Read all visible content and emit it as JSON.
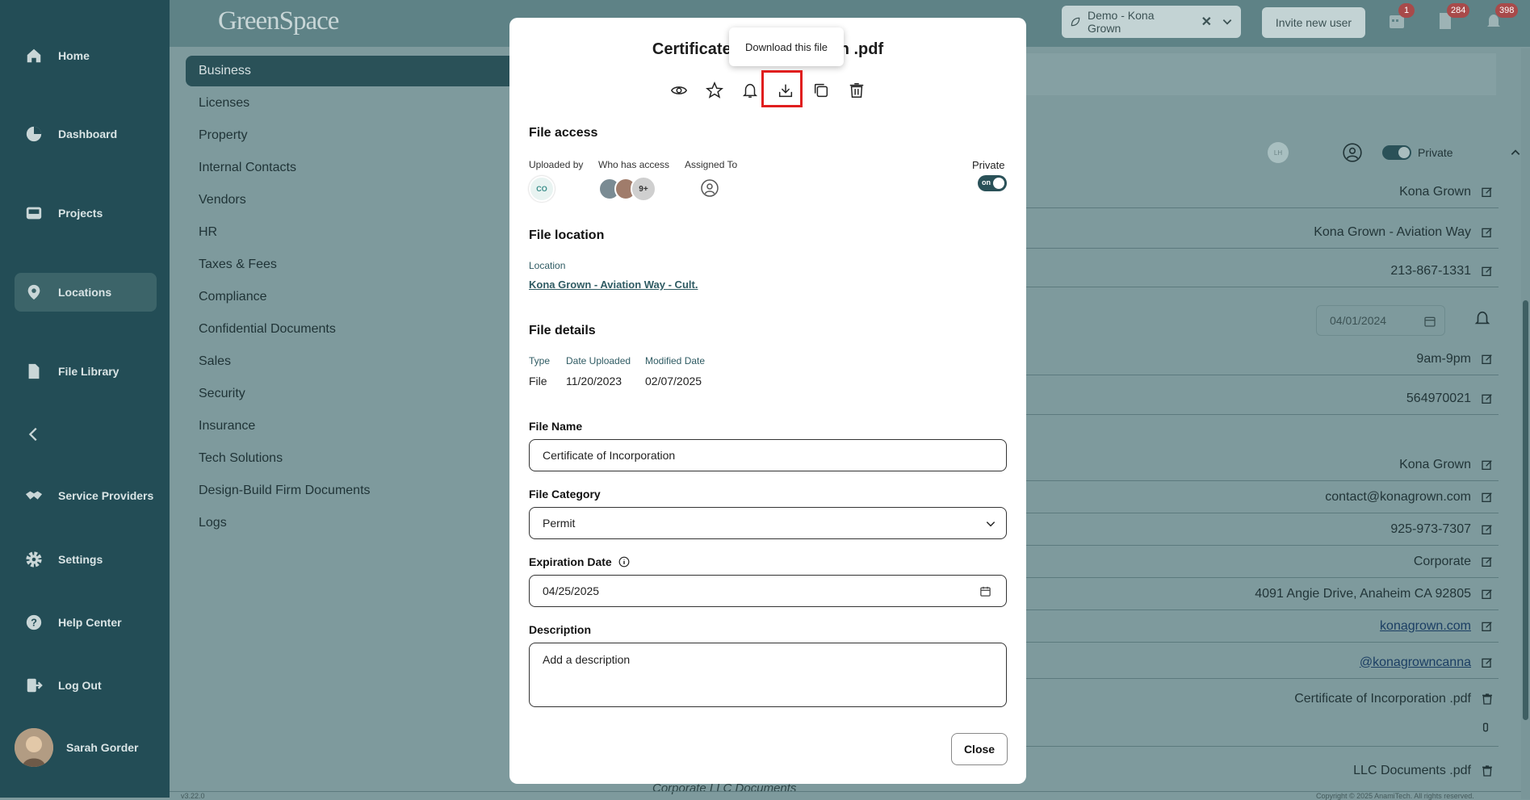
{
  "sidebar": {
    "items": [
      {
        "label": "Home",
        "icon": "home-icon"
      },
      {
        "label": "Dashboard",
        "icon": "pie-chart-icon"
      },
      {
        "label": "Projects",
        "icon": "inbox-icon"
      },
      {
        "label": "Locations",
        "icon": "map-pin-icon"
      },
      {
        "label": "File Library",
        "icon": "file-icon"
      },
      {
        "label": "Service Providers",
        "icon": "handshake-icon"
      },
      {
        "label": "Settings",
        "icon": "gear-icon"
      },
      {
        "label": "Help Center",
        "icon": "help-icon"
      },
      {
        "label": "Log Out",
        "icon": "logout-icon"
      }
    ],
    "user_name": "Sarah Gorder"
  },
  "header": {
    "logo": "GreenSpace",
    "org": "Demo - Kona Grown",
    "invite": "Invite new user",
    "badges": [
      "1",
      "284",
      "398"
    ]
  },
  "categories": [
    "Business",
    "Licenses",
    "Property",
    "Internal Contacts",
    "Vendors",
    "HR",
    "Taxes & Fees",
    "Compliance",
    "Confidential Documents",
    "Sales",
    "Security",
    "Insurance",
    "Tech Solutions",
    "Design-Build Firm Documents",
    "Logs"
  ],
  "right": {
    "owner_initials": "LH",
    "private_label": "Private",
    "toggle_text": "on",
    "rows": [
      "Kona Grown",
      "Kona Grown - Aviation Way",
      "213-867-1331",
      "9am-9pm",
      "564970021",
      "Kona Grown",
      "contact@konagrown.com",
      "925-973-7307",
      "Corporate",
      "4091 Angie Drive, Anaheim CA 92805",
      "konagrown.com",
      "@konagrowncanna",
      "Certificate of Incorporation .pdf",
      "LLC Documents .pdf"
    ],
    "date": "04/01/2024",
    "bottom_partial": "Corporate LLC Documents",
    "version": "v3.22.0",
    "copyright": "Copyright © 2025 AnamiTech. All rights reserved."
  },
  "modal": {
    "title_left": "Certificate",
    "title_right": "n .pdf",
    "tooltip": "Download this file",
    "toolbar": [
      "eye-icon",
      "star-icon",
      "bell-icon",
      "download-icon",
      "copy-icon",
      "trash-icon"
    ],
    "file_access": {
      "heading": "File access",
      "uploaded_by": "Uploaded by",
      "uploader_initials": "CO",
      "who_has_access": "Who has access",
      "more_count": "9+",
      "assigned_to": "Assigned To",
      "private": "Private",
      "toggle_text": "on"
    },
    "file_location": {
      "heading": "File location",
      "label": "Location",
      "value": "Kona Grown - Aviation Way - Cult."
    },
    "file_details": {
      "heading": "File details",
      "type_label": "Type",
      "type_value": "File",
      "uploaded_label": "Date Uploaded",
      "uploaded_value": "11/20/2023",
      "modified_label": "Modified Date",
      "modified_value": "02/07/2025"
    },
    "file_name": {
      "label": "File Name",
      "value": "Certificate of Incorporation"
    },
    "file_category": {
      "label": "File Category",
      "value": "Permit"
    },
    "expiration": {
      "label": "Expiration Date",
      "value": "04/25/2025"
    },
    "description": {
      "label": "Description",
      "placeholder": "Add a description"
    },
    "close": "Close"
  },
  "colors": {
    "sidebar": "#234d56",
    "accent": "#2a5158",
    "highlight": "#e01e1e",
    "link": "#1b3e63"
  }
}
